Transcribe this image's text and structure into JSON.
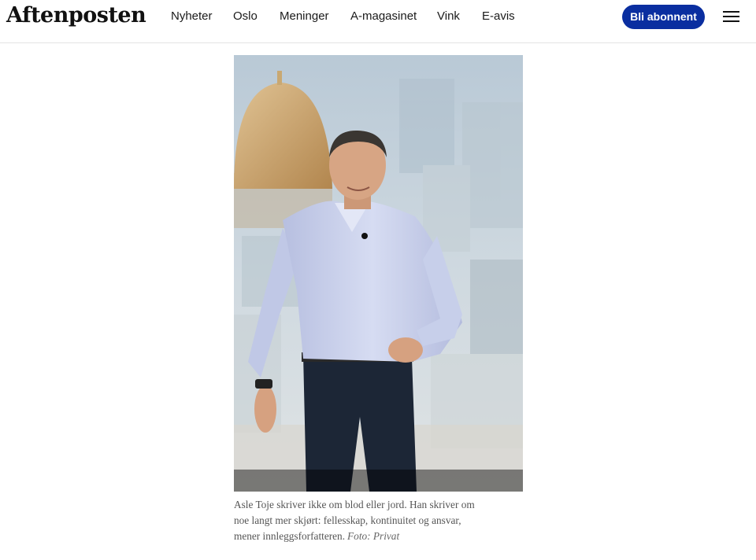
{
  "header": {
    "logo": "Aftenposten",
    "nav": [
      "Nyheter",
      "Oslo",
      "Meninger",
      "A-magasinet",
      "Vink",
      "E-avis"
    ],
    "subscribe_label": "Bli abonnent",
    "menu_icon": "hamburger-menu-icon"
  },
  "article": {
    "image_subject": "man in light blue shirt walking, domed building and city in background",
    "caption_line1": "Asle Toje skriver ikke om blod eller jord. Han skriver om",
    "caption_line2": "noe langt mer skjørt: fellesskap, kontinuitet og ansvar,",
    "caption_line3": "mener innleggsforfatteren.",
    "credit": "Foto: Privat"
  },
  "colors": {
    "accent": "#0a2ea0",
    "sky": "#c9d5de",
    "shirt": "#c4cbe6",
    "trousers": "#1c2636",
    "dome": "#c59a62"
  }
}
